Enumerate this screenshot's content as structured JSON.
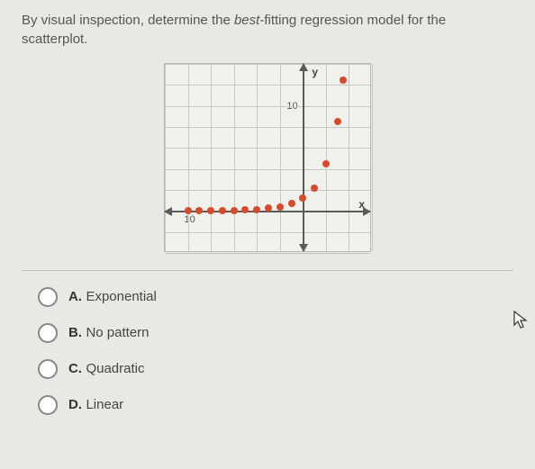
{
  "question": {
    "prefix": "By visual inspection, determine the ",
    "emph": "best",
    "suffix": "-fitting regression model for the scatterplot."
  },
  "chart_data": {
    "type": "scatter",
    "xlabel": "x",
    "ylabel": "y",
    "xlim": [
      -12,
      6
    ],
    "ylim": [
      -4,
      14
    ],
    "xtick": "10",
    "ytick": "10",
    "points": [
      {
        "x": -10,
        "y": 0.0
      },
      {
        "x": -9,
        "y": 0.0
      },
      {
        "x": -8,
        "y": 0.0
      },
      {
        "x": -7,
        "y": 0.0
      },
      {
        "x": -6,
        "y": 0.05
      },
      {
        "x": -5,
        "y": 0.1
      },
      {
        "x": -4,
        "y": 0.15
      },
      {
        "x": -3,
        "y": 0.25
      },
      {
        "x": -2,
        "y": 0.4
      },
      {
        "x": -1,
        "y": 0.7
      },
      {
        "x": 0,
        "y": 1.2
      },
      {
        "x": 1,
        "y": 2.2
      },
      {
        "x": 2,
        "y": 4.5
      },
      {
        "x": 3,
        "y": 8.5
      },
      {
        "x": 3.5,
        "y": 12.5
      }
    ]
  },
  "options": [
    {
      "letter": "A.",
      "text": "Exponential"
    },
    {
      "letter": "B.",
      "text": "No pattern"
    },
    {
      "letter": "C.",
      "text": "Quadratic"
    },
    {
      "letter": "D.",
      "text": "Linear"
    }
  ]
}
